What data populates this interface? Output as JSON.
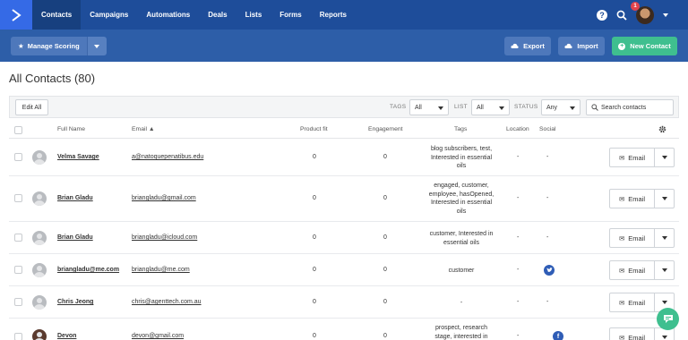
{
  "nav": {
    "items": [
      {
        "label": "Contacts",
        "active": true
      },
      {
        "label": "Campaigns"
      },
      {
        "label": "Automations"
      },
      {
        "label": "Deals"
      },
      {
        "label": "Lists"
      },
      {
        "label": "Forms"
      },
      {
        "label": "Reports"
      }
    ],
    "notification_count": "1",
    "help_glyph": "?"
  },
  "toolbar": {
    "manage_scoring": "Manage Scoring",
    "export": "Export",
    "import": "Import",
    "new_contact": "New Contact"
  },
  "page": {
    "title": "All Contacts (80)"
  },
  "filters": {
    "edit_all": "Edit All",
    "tags_label": "TAGS",
    "tags_value": "All",
    "list_label": "LIST",
    "list_value": "All",
    "status_label": "STATUS",
    "status_value": "Any",
    "search_placeholder": "Search contacts"
  },
  "table": {
    "headers": {
      "full_name": "Full Name",
      "email": "Email ▲",
      "product_fit": "Product fit",
      "engagement": "Engagement",
      "tags": "Tags",
      "location": "Location",
      "social": "Social"
    },
    "email_button": "Email",
    "rows": [
      {
        "name": "Velma Savage",
        "email": "a@natoquepenatibus.edu",
        "product_fit": "0",
        "engagement": "0",
        "tags": [
          "blog subscribers, test,",
          "Interested in essential",
          "oils"
        ],
        "location": "-",
        "social": "-"
      },
      {
        "name": "Brian Gladu",
        "email": "briangladu@gmail.com",
        "product_fit": "0",
        "engagement": "0",
        "tags": [
          "engaged, customer,",
          "employee, hasOpened,",
          "Interested in essential",
          "oils"
        ],
        "location": "-",
        "social": "-"
      },
      {
        "name": "Brian Gladu",
        "email": "briangladu@icloud.com",
        "product_fit": "0",
        "engagement": "0",
        "tags": [
          "customer, Interested in",
          "essential oils"
        ],
        "location": "-",
        "social": "-"
      },
      {
        "name": "briangladu@me.com",
        "email": "briangladu@me.com",
        "product_fit": "0",
        "engagement": "0",
        "tags": [
          "customer"
        ],
        "location": "-",
        "social": "twitter-icon"
      },
      {
        "name": "Chris Jeong",
        "email": "chris@agenttech.com.au",
        "product_fit": "0",
        "engagement": "0",
        "tags": [
          "-"
        ],
        "location": "-",
        "social": "-"
      },
      {
        "name": "Devon",
        "email": "devon@gmail.com",
        "product_fit": "0",
        "engagement": "0",
        "tags": [
          "prospect, research",
          "stage, interested in"
        ],
        "location": "-",
        "social": "facebook-icon"
      }
    ]
  },
  "colors": {
    "nav_bg": "#1e4d9a",
    "subheader_bg": "#2d5ea8",
    "accent_green": "#3fbf8f"
  }
}
